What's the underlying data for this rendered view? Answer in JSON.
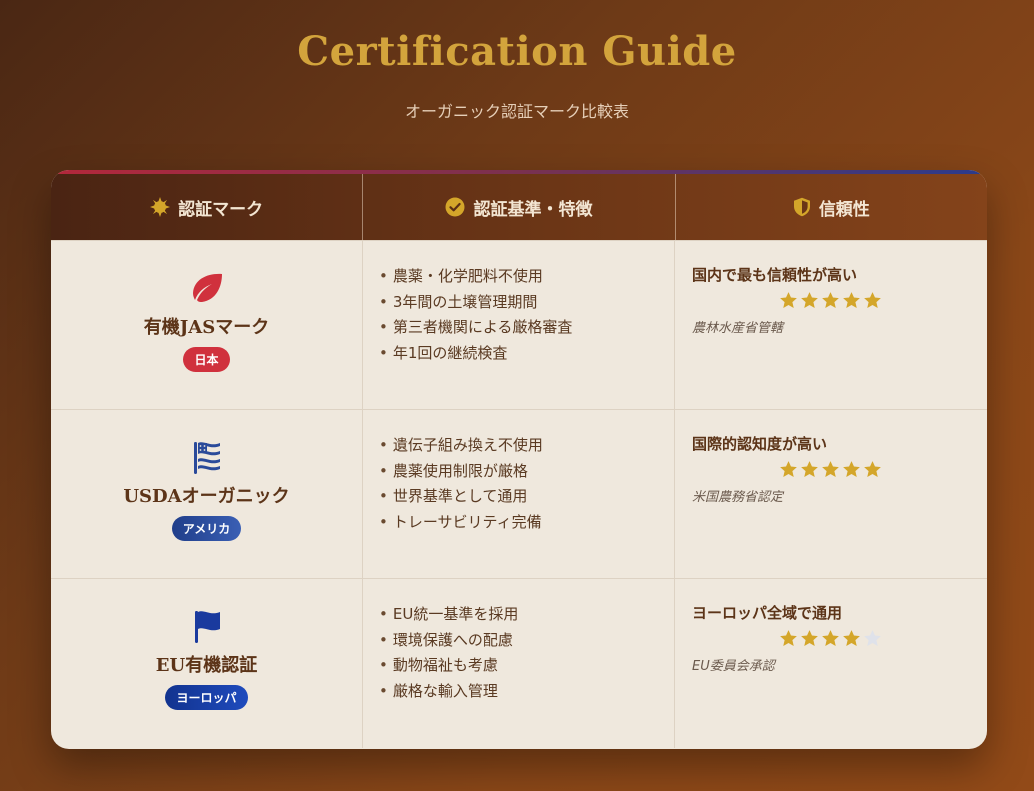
{
  "header": {
    "title": "Certification Guide",
    "subtitle": "オーガニック認証マーク比較表"
  },
  "table": {
    "columns": [
      {
        "label": "認証マーク",
        "icon": "sun-badge-icon"
      },
      {
        "label": "認証基準・特徴",
        "icon": "check-circle-icon"
      },
      {
        "label": "信頼性",
        "icon": "shield-icon"
      }
    ],
    "rows": [
      {
        "name": "有機JASマーク",
        "icon": "leaf-icon",
        "badge": "日本",
        "badge_color": "#d0313d",
        "features": [
          "農薬・化学肥料不使用",
          "3年間の土壌管理期間",
          "第三者機関による厳格審査",
          "年1回の継続検査"
        ],
        "trust": "国内で最も信頼性が高い",
        "rating": 5,
        "authority": "農林水産省管轄"
      },
      {
        "name": "USDAオーガニック",
        "icon": "us-flag-icon",
        "badge": "アメリカ",
        "badge_color": "#2a4a9a",
        "features": [
          "遺伝子組み換え不使用",
          "農薬使用制限が厳格",
          "世界基準として通用",
          "トレーサビリティ完備"
        ],
        "trust": "国際的認知度が高い",
        "rating": 5,
        "authority": "米国農務省認定"
      },
      {
        "name": "EU有機認証",
        "icon": "flag-icon",
        "badge": "ヨーロッパ",
        "badge_color": "#1a3a9e",
        "features": [
          "EU統一基準を採用",
          "環境保護への配慮",
          "動物福祉も考慮",
          "厳格な輸入管理"
        ],
        "trust": "ヨーロッパ全域で通用",
        "rating": 4,
        "authority": "EU委員会承認"
      }
    ],
    "max_rating": 5
  },
  "colors": {
    "title": "#d3a43c",
    "star_filled": "#d4a62a",
    "star_empty": "#dfe2ea",
    "leaf_icon": "#d0313d",
    "us_flag_icon": "#2a4a9a",
    "eu_flag_icon": "#1a3a9e"
  }
}
